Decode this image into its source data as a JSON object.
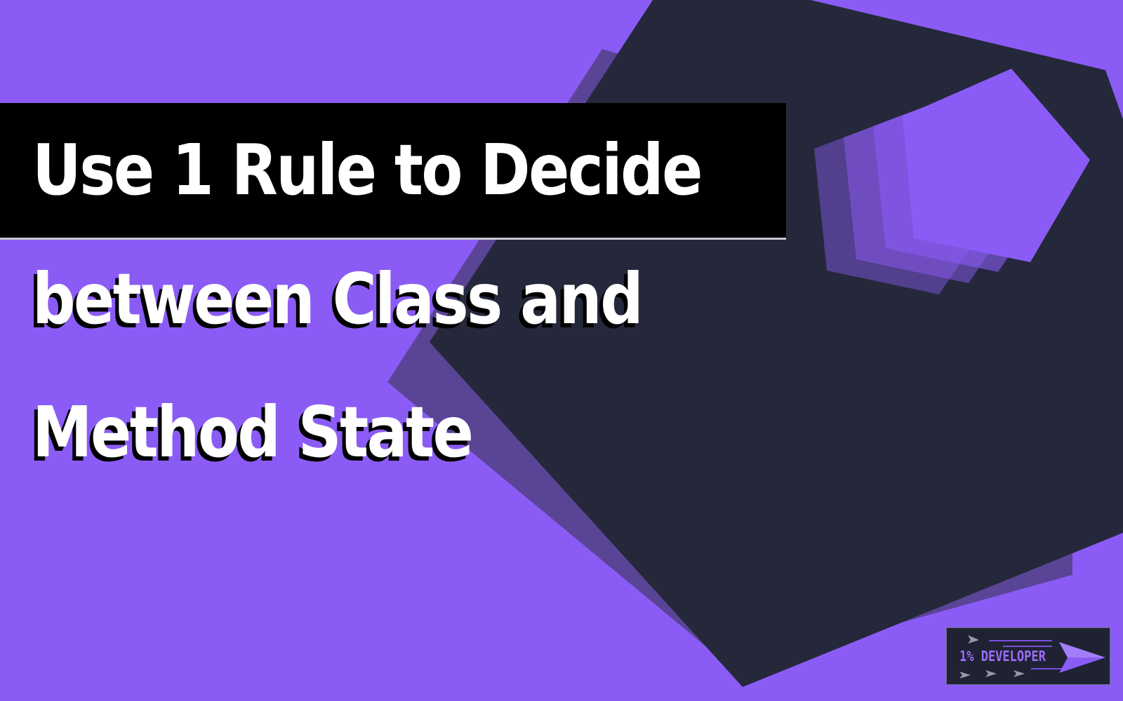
{
  "thumbnail": {
    "title_lines": [
      "Use 1 Rule to Decide",
      "between Class and",
      "Method State"
    ]
  },
  "logo": {
    "text": "1% DEVELOPER"
  },
  "colors": {
    "background": "#8b5cf5",
    "dark_shape": "#24283a",
    "shadow_shape": "#5a4496",
    "accent": "#8b5cf5",
    "title_text": "#ffffff",
    "title_bar": "#000000"
  }
}
